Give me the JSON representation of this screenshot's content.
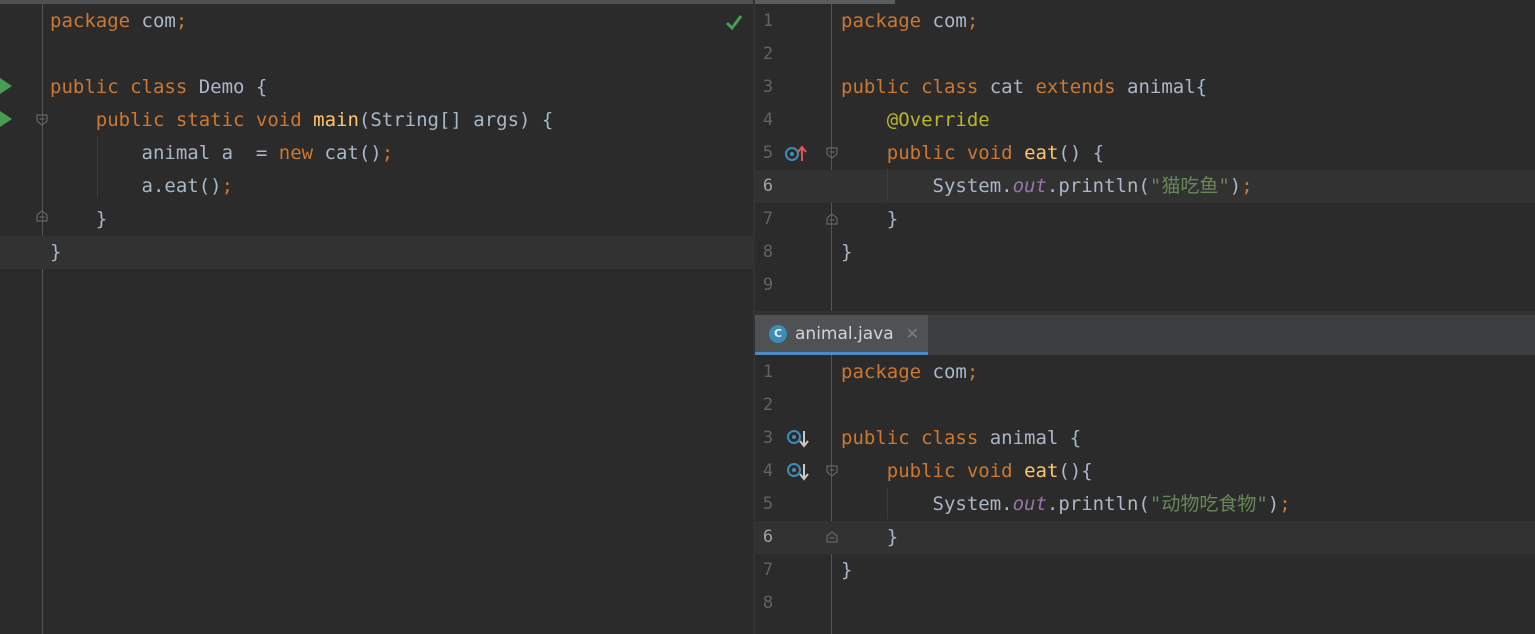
{
  "left_editor": {
    "lines": [
      {
        "parts": [
          {
            "t": "package",
            "c": "kw"
          },
          {
            "t": " com"
          },
          {
            "t": ";",
            "c": "kw"
          }
        ]
      },
      {
        "parts": []
      },
      {
        "parts": [
          {
            "t": "public class",
            "c": "kw"
          },
          {
            "t": " Demo {"
          }
        ]
      },
      {
        "parts": [
          {
            "t": "    "
          },
          {
            "t": "public static void",
            "c": "kw"
          },
          {
            "t": " "
          },
          {
            "t": "main",
            "c": "fn"
          },
          {
            "t": "(String[] args) {"
          }
        ]
      },
      {
        "parts": [
          {
            "t": "        animal a  = "
          },
          {
            "t": "new",
            "c": "kw"
          },
          {
            "t": " cat()"
          },
          {
            "t": ";",
            "c": "kw"
          }
        ]
      },
      {
        "parts": [
          {
            "t": "        a.eat()"
          },
          {
            "t": ";",
            "c": "kw"
          }
        ]
      },
      {
        "parts": [
          {
            "t": "    }"
          }
        ]
      },
      {
        "parts": [
          {
            "t": "}"
          }
        ]
      }
    ],
    "current_line": 8
  },
  "cat_editor": {
    "line_numbers": [
      "1",
      "2",
      "3",
      "4",
      "5",
      "6",
      "7",
      "8",
      "9"
    ],
    "lines": [
      {
        "parts": [
          {
            "t": "package",
            "c": "kw"
          },
          {
            "t": " com"
          },
          {
            "t": ";",
            "c": "kw"
          }
        ]
      },
      {
        "parts": []
      },
      {
        "parts": [
          {
            "t": "public class",
            "c": "kw"
          },
          {
            "t": " cat "
          },
          {
            "t": "extends",
            "c": "kw"
          },
          {
            "t": " animal{"
          }
        ]
      },
      {
        "parts": [
          {
            "t": "    "
          },
          {
            "t": "@Override",
            "c": "an"
          }
        ]
      },
      {
        "parts": [
          {
            "t": "    "
          },
          {
            "t": "public void",
            "c": "kw"
          },
          {
            "t": " "
          },
          {
            "t": "eat",
            "c": "fn"
          },
          {
            "t": "() {"
          }
        ]
      },
      {
        "parts": [
          {
            "t": "        System."
          },
          {
            "t": "out",
            "c": "it"
          },
          {
            "t": ".println("
          },
          {
            "t": "\"猫吃鱼\"",
            "c": "st"
          },
          {
            "t": ")"
          },
          {
            "t": ";",
            "c": "kw"
          }
        ]
      },
      {
        "parts": [
          {
            "t": "    }"
          }
        ]
      },
      {
        "parts": [
          {
            "t": "}"
          }
        ]
      },
      {
        "parts": []
      }
    ],
    "current_line": 6
  },
  "tab": {
    "label": "animal.java",
    "icon_letter": "C"
  },
  "animal_editor": {
    "line_numbers": [
      "1",
      "2",
      "3",
      "4",
      "5",
      "6",
      "7",
      "8"
    ],
    "lines": [
      {
        "parts": [
          {
            "t": "package",
            "c": "kw"
          },
          {
            "t": " com"
          },
          {
            "t": ";",
            "c": "kw"
          }
        ]
      },
      {
        "parts": []
      },
      {
        "parts": [
          {
            "t": "public class",
            "c": "kw"
          },
          {
            "t": " animal {"
          }
        ]
      },
      {
        "parts": [
          {
            "t": "    "
          },
          {
            "t": "public void",
            "c": "kw"
          },
          {
            "t": " "
          },
          {
            "t": "eat",
            "c": "fn"
          },
          {
            "t": "(){"
          }
        ]
      },
      {
        "parts": [
          {
            "t": "        System."
          },
          {
            "t": "out",
            "c": "it"
          },
          {
            "t": ".println("
          },
          {
            "t": "\"动物吃食物\"",
            "c": "st"
          },
          {
            "t": ")"
          },
          {
            "t": ";",
            "c": "kw"
          }
        ]
      },
      {
        "parts": [
          {
            "t": "    }"
          }
        ]
      },
      {
        "parts": [
          {
            "t": "}"
          }
        ]
      },
      {
        "parts": []
      }
    ],
    "current_line": 6
  },
  "colors": {
    "keyword": "#cc7832",
    "function": "#ffc66d",
    "string": "#6a8759",
    "annotation": "#bbb529",
    "field": "#9876aa",
    "text": "#a9b7c6",
    "check": "#499c54"
  }
}
